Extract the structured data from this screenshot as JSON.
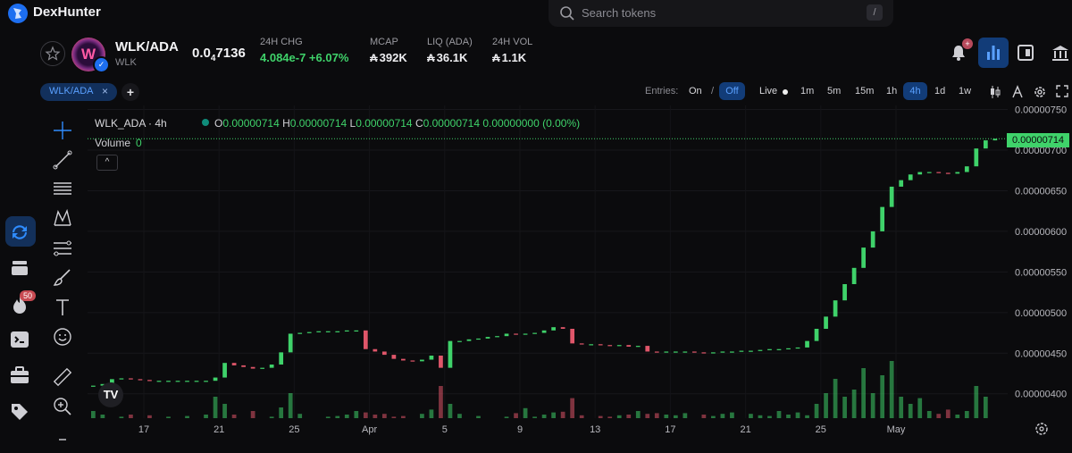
{
  "app": {
    "brand": "DexHunter"
  },
  "search": {
    "placeholder": "Search tokens",
    "shortcut": "/"
  },
  "token": {
    "pair": "WLK/ADA",
    "symbol": "WLK",
    "avatar_letter": "W",
    "price_prefix": "0.0",
    "price_zeros": "4",
    "price_digits": "7136",
    "stats": {
      "chg_label": "24H CHG",
      "chg_value": "4.084e-7 +6.07%",
      "mcap_label": "MCAP",
      "mcap_value": "392K",
      "liq_label": "LIQ (ADA)",
      "liq_value": "36.1K",
      "vol_label": "24H VOL",
      "vol_value": "1.1K"
    }
  },
  "notifications": {
    "badge": "+"
  },
  "tabs": [
    {
      "label": "WLK/ADA",
      "close": "×"
    }
  ],
  "add_tab": "+",
  "toolbar": {
    "entries_label": "Entries:",
    "entries_on": "On",
    "entries_sep": "/",
    "entries_off": "Off",
    "live": "Live",
    "timeframes": [
      "1m",
      "5m",
      "15m",
      "1h",
      "4h",
      "1d",
      "1w"
    ],
    "active_timeframe": "4h"
  },
  "sidebar": {
    "fire_badge": "50"
  },
  "legend": {
    "title": "WLK_ADA · 4h",
    "o_key": "O",
    "o": "0.00000714",
    "h_key": "H",
    "h": "0.00000714",
    "l_key": "L",
    "l": "0.00000714",
    "c_key": "C",
    "c": "0.00000714",
    "change": "0.00000000 (0.00%)",
    "volume_label": "Volume",
    "volume_value": "0",
    "collapse": "^"
  },
  "tv_logo": "TV",
  "colors": {
    "up": "#3fd26a",
    "down": "#e0566a",
    "accent": "#1d6ef0",
    "bg": "#0b0b0d"
  },
  "chart_data": {
    "type": "candlestick",
    "ylim": [
      3.7e-06,
      7.55e-06
    ],
    "y_ticks": [
      "0.00000750",
      "0.00000700",
      "0.00000650",
      "0.00000600",
      "0.00000550",
      "0.00000500",
      "0.00000450",
      "0.00000400"
    ],
    "y_tick_values": [
      7.5e-06,
      7e-06,
      6.5e-06,
      6e-06,
      5.5e-06,
      5e-06,
      4.5e-06,
      4e-06
    ],
    "x_ticks": [
      "17",
      "21",
      "25",
      "Apr",
      "5",
      "9",
      "13",
      "17",
      "21",
      "25",
      "May"
    ],
    "last_price": "0.00000714",
    "last_price_value": 7.14e-06,
    "close_series": [
      4.1e-06,
      4.12e-06,
      4.18e-06,
      4.19e-06,
      4.18e-06,
      4.17e-06,
      4.16e-06,
      4.16e-06,
      4.16e-06,
      4.16e-06,
      4.16e-06,
      4.16e-06,
      4.16e-06,
      4.2e-06,
      4.38e-06,
      4.35e-06,
      4.33e-06,
      4.31e-06,
      4.32e-06,
      4.36e-06,
      4.51e-06,
      4.74e-06,
      4.75e-06,
      4.76e-06,
      4.77e-06,
      4.77e-06,
      4.77e-06,
      4.78e-06,
      4.78e-06,
      4.55e-06,
      4.52e-06,
      4.48e-06,
      4.43e-06,
      4.41e-06,
      4.4e-06,
      4.42e-06,
      4.47e-06,
      4.32e-06,
      4.65e-06,
      4.65e-06,
      4.67e-06,
      4.68e-06,
      4.7e-06,
      4.71e-06,
      4.74e-06,
      4.73e-06,
      4.74e-06,
      4.75e-06,
      4.78e-06,
      4.82e-06,
      4.8e-06,
      4.62e-06,
      4.61e-06,
      4.61e-06,
      4.6e-06,
      4.59e-06,
      4.6e-06,
      4.58e-06,
      4.59e-06,
      4.52e-06,
      4.51e-06,
      4.52e-06,
      4.52e-06,
      4.52e-06,
      4.51e-06,
      4.5e-06,
      4.51e-06,
      4.52e-06,
      4.52e-06,
      4.53e-06,
      4.53e-06,
      4.54e-06,
      4.55e-06,
      4.55e-06,
      4.56e-06,
      4.57e-06,
      4.65e-06,
      4.8e-06,
      4.95e-06,
      5.15e-06,
      5.35e-06,
      5.55e-06,
      5.8e-06,
      6e-06,
      6.3e-06,
      6.55e-06,
      6.63e-06,
      6.7e-06,
      6.73e-06,
      6.73e-06,
      6.72e-06,
      6.71e-06,
      6.73e-06,
      6.8e-06,
      7.02e-06,
      7.12e-06,
      7.14e-06
    ],
    "volume_series": [
      0.1,
      0.05,
      0.0,
      0.02,
      0.05,
      0.0,
      0.04,
      0.0,
      0.02,
      0.0,
      0.03,
      0.0,
      0.05,
      0.3,
      0.2,
      0.05,
      0.0,
      0.1,
      0.0,
      0.02,
      0.15,
      0.35,
      0.06,
      0.0,
      0.0,
      0.02,
      0.03,
      0.05,
      0.1,
      0.08,
      0.05,
      0.06,
      0.02,
      0.03,
      0.0,
      0.06,
      0.12,
      0.45,
      0.2,
      0.06,
      0.0,
      0.03,
      0.0,
      0.0,
      0.02,
      0.07,
      0.14,
      0.02,
      0.05,
      0.08,
      0.09,
      0.28,
      0.04,
      0.0,
      0.03,
      0.02,
      0.04,
      0.05,
      0.1,
      0.06,
      0.07,
      0.05,
      0.04,
      0.07,
      0.0,
      0.05,
      0.03,
      0.06,
      0.08,
      0.0,
      0.06,
      0.04,
      0.03,
      0.1,
      0.05,
      0.08,
      0.04,
      0.2,
      0.35,
      0.55,
      0.3,
      0.4,
      0.7,
      0.35,
      0.6,
      0.8,
      0.3,
      0.2,
      0.28,
      0.1,
      0.06,
      0.12,
      0.05,
      0.1,
      0.45,
      0.3,
      0.0
    ]
  }
}
